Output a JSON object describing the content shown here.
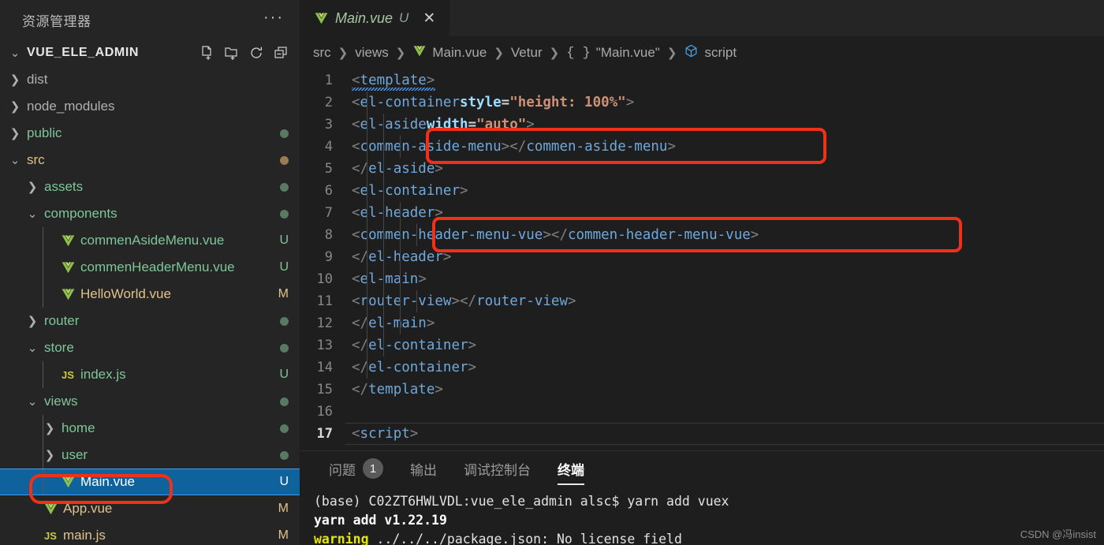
{
  "sidebar": {
    "title": "资源管理器",
    "more_label": "···",
    "project": "VUE_ELE_ADMIN",
    "actions": [
      {
        "name": "new-file-icon",
        "label": "新建文件"
      },
      {
        "name": "new-folder-icon",
        "label": "新建文件夹"
      },
      {
        "name": "refresh-icon",
        "label": "刷新"
      },
      {
        "name": "collapse-all-icon",
        "label": "全部折叠"
      }
    ],
    "items": [
      {
        "label": "dist",
        "depth": 1,
        "twist": "collapsed",
        "icon": "none",
        "color": "#b0b0b0",
        "badge": "",
        "dot": ""
      },
      {
        "label": "node_modules",
        "depth": 1,
        "twist": "collapsed",
        "icon": "none",
        "color": "#b0b0b0",
        "badge": "",
        "dot": ""
      },
      {
        "label": "public",
        "depth": 1,
        "twist": "collapsed",
        "icon": "none",
        "color": "#7ec699",
        "badge": "",
        "dot": "#587a61"
      },
      {
        "label": "src",
        "depth": 1,
        "twist": "expanded",
        "icon": "none",
        "color": "#e0c28a",
        "badge": "",
        "dot": "#9a7b52"
      },
      {
        "label": "assets",
        "depth": 2,
        "twist": "collapsed",
        "icon": "none",
        "color": "#7ec699",
        "badge": "",
        "dot": "#587a61"
      },
      {
        "label": "components",
        "depth": 2,
        "twist": "expanded",
        "icon": "none",
        "color": "#7ec699",
        "badge": "",
        "dot": "#587a61"
      },
      {
        "label": "commenAsideMenu.vue",
        "depth": 3,
        "twist": "none",
        "icon": "vue",
        "color": "#7ec699",
        "badge": "U",
        "badge_color": "#7ec699",
        "dot": ""
      },
      {
        "label": "commenHeaderMenu.vue",
        "depth": 3,
        "twist": "none",
        "icon": "vue",
        "color": "#7ec699",
        "badge": "U",
        "badge_color": "#7ec699",
        "dot": ""
      },
      {
        "label": "HelloWorld.vue",
        "depth": 3,
        "twist": "none",
        "icon": "vue",
        "color": "#e0c28a",
        "badge": "M",
        "badge_color": "#e0c28a",
        "dot": ""
      },
      {
        "label": "router",
        "depth": 2,
        "twist": "collapsed",
        "icon": "none",
        "color": "#7ec699",
        "badge": "",
        "dot": "#587a61"
      },
      {
        "label": "store",
        "depth": 2,
        "twist": "expanded",
        "icon": "none",
        "color": "#7ec699",
        "badge": "",
        "dot": "#587a61"
      },
      {
        "label": "index.js",
        "depth": 3,
        "twist": "none",
        "icon": "js",
        "color": "#7ec699",
        "badge": "U",
        "badge_color": "#7ec699",
        "dot": ""
      },
      {
        "label": "views",
        "depth": 2,
        "twist": "expanded",
        "icon": "none",
        "color": "#7ec699",
        "badge": "",
        "dot": "#587a61"
      },
      {
        "label": "home",
        "depth": 3,
        "twist": "collapsed",
        "icon": "none",
        "color": "#7ec699",
        "badge": "",
        "dot": "#587a61"
      },
      {
        "label": "user",
        "depth": 3,
        "twist": "collapsed",
        "icon": "none",
        "color": "#7ec699",
        "badge": "",
        "dot": "#587a61"
      },
      {
        "label": "Main.vue",
        "depth": 3,
        "twist": "none",
        "icon": "vue",
        "color": "#ffffff",
        "badge": "U",
        "badge_color": "#ffffff",
        "dot": "",
        "selected": true,
        "highlighted": true
      },
      {
        "label": "App.vue",
        "depth": 2,
        "twist": "none",
        "icon": "vue",
        "color": "#e0c28a",
        "badge": "M",
        "badge_color": "#e0c28a",
        "dot": ""
      },
      {
        "label": "main.js",
        "depth": 2,
        "twist": "none",
        "icon": "js",
        "color": "#e0c28a",
        "badge": "M",
        "badge_color": "#e0c28a",
        "dot": ""
      }
    ]
  },
  "editor": {
    "tab": {
      "name": "Main.vue",
      "status": "U",
      "close": "✕"
    },
    "breadcrumb": [
      {
        "label": "src",
        "icon": "none"
      },
      {
        "label": "views",
        "icon": "none"
      },
      {
        "label": "Main.vue",
        "icon": "vue"
      },
      {
        "label": "Vetur",
        "icon": "none"
      },
      {
        "label": "\"Main.vue\"",
        "icon": "braces"
      },
      {
        "label": "script",
        "icon": "symbol-module"
      }
    ],
    "breadcrumb_separator": "❯",
    "current_line": 17,
    "lines": [
      {
        "n": 1,
        "text": "<template>",
        "indent": 0
      },
      {
        "n": 2,
        "text": "  <el-container style=\"height: 100%\">",
        "indent": 1
      },
      {
        "n": 3,
        "text": "    <el-aside width=\"auto\">",
        "indent": 2
      },
      {
        "n": 4,
        "text": "      <commen-aside-menu></commen-aside-menu>",
        "indent": 3
      },
      {
        "n": 5,
        "text": "    </el-aside>",
        "indent": 2
      },
      {
        "n": 6,
        "text": "    <el-container>",
        "indent": 2
      },
      {
        "n": 7,
        "text": "      <el-header>",
        "indent": 3
      },
      {
        "n": 8,
        "text": "        <commen-header-menu-vue></commen-header-menu-vue>",
        "indent": 4
      },
      {
        "n": 9,
        "text": "      </el-header>",
        "indent": 3
      },
      {
        "n": 10,
        "text": "      <el-main>",
        "indent": 3
      },
      {
        "n": 11,
        "text": "        <router-view></router-view>",
        "indent": 4
      },
      {
        "n": 12,
        "text": "      </el-main>",
        "indent": 3
      },
      {
        "n": 13,
        "text": "    </el-container>",
        "indent": 2
      },
      {
        "n": 14,
        "text": "  </el-container>",
        "indent": 1
      },
      {
        "n": 15,
        "text": "</template>",
        "indent": 0
      },
      {
        "n": 16,
        "text": "",
        "indent": 0
      },
      {
        "n": 17,
        "text": "<script>",
        "indent": 0
      }
    ]
  },
  "panel": {
    "tabs": [
      {
        "label": "问题",
        "badge": "1",
        "active": false
      },
      {
        "label": "输出",
        "badge": "",
        "active": false
      },
      {
        "label": "调试控制台",
        "badge": "",
        "active": false
      },
      {
        "label": "终端",
        "badge": "",
        "active": true
      }
    ],
    "terminal_lines": [
      {
        "text": "(base) C02ZT6HWLVDL:vue_ele_admin alsc$ yarn add vuex",
        "style": "normal"
      },
      {
        "text": "yarn add v1.22.19",
        "style": "bold"
      },
      {
        "text": "warning ../../../package.json: No license field",
        "style": "warn"
      }
    ]
  },
  "watermark": "CSDN @冯insist",
  "colors": {
    "accent_highlight": "#f03018",
    "selection": "#0e639c",
    "sidebar_bg": "#252526",
    "editor_bg": "#1e1e1e"
  }
}
